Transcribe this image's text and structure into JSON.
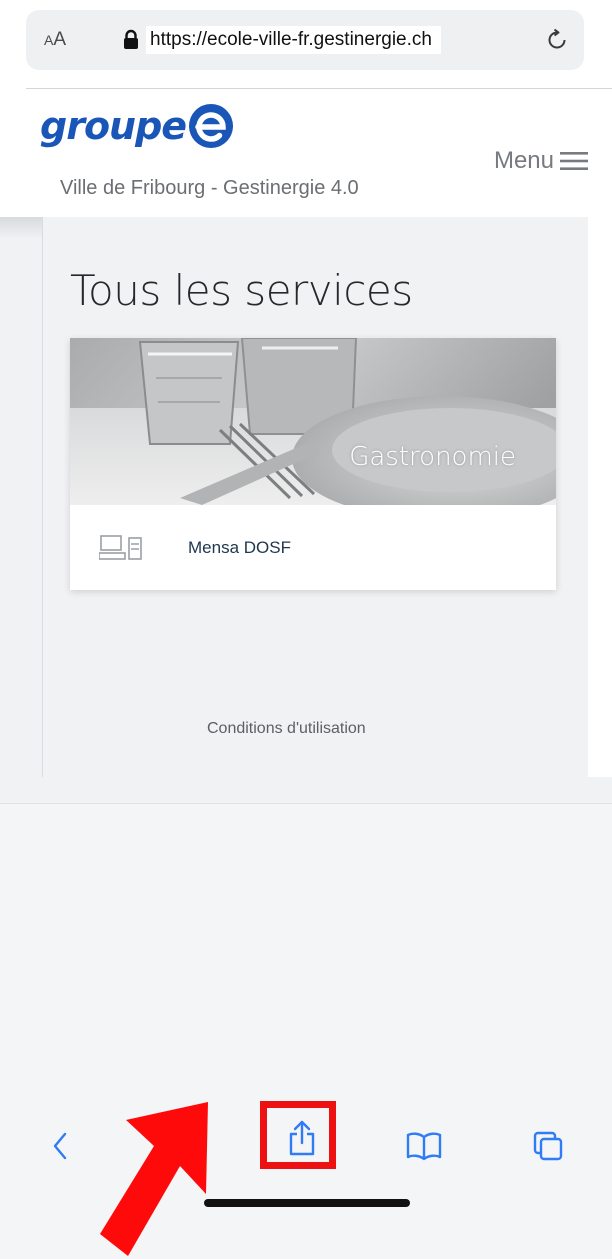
{
  "browser": {
    "text_size_button": {
      "small": "A",
      "large": "A"
    },
    "url": "https://ecole-ville-fr.gestinergie.ch"
  },
  "header": {
    "logo_text": "groupe",
    "menu_label": "Menu",
    "subtitle": "Ville de Fribourg - Gestinergie 4.0"
  },
  "main": {
    "title": "Tous les services",
    "card": {
      "category": "Gastronomie",
      "link_label": "Mensa DOSF",
      "icon": "kiosk-terminal-icon"
    },
    "footer_link": "Conditions d'utilisation"
  },
  "toolbar": {
    "buttons": [
      "back-icon",
      "forward-icon",
      "share-icon",
      "bookmarks-icon",
      "tabs-icon"
    ],
    "highlighted_button": "share"
  },
  "colors": {
    "brand_blue": "#1a55b8",
    "safari_blue": "#2f7cf6",
    "highlight_red": "#ee1111"
  }
}
